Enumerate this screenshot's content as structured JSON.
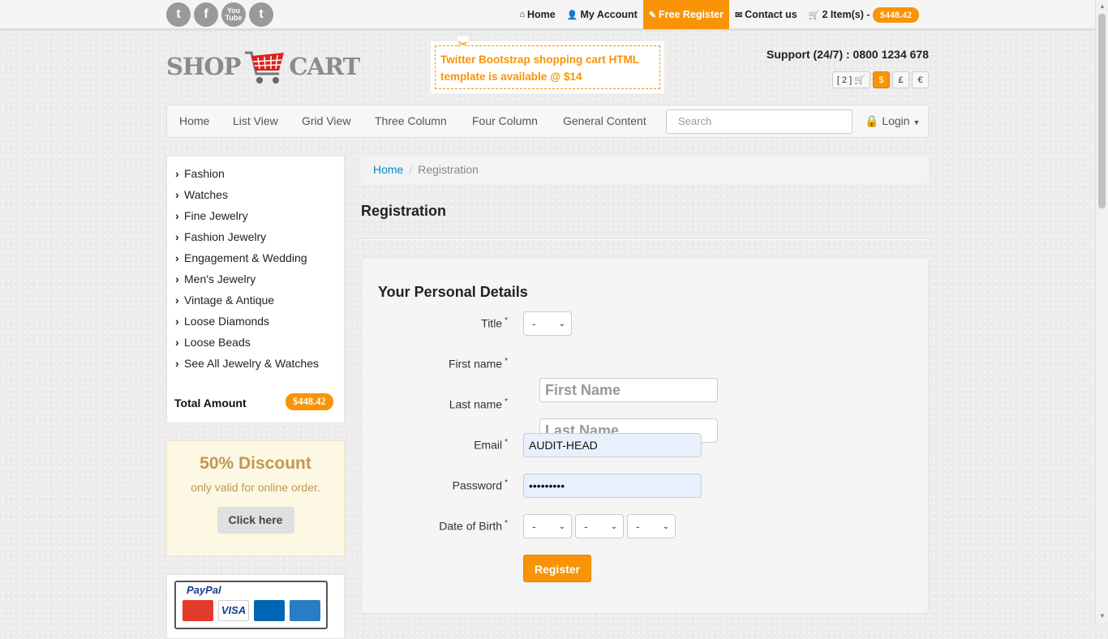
{
  "social": [
    {
      "icon": "twitter-icon",
      "glyph": "t"
    },
    {
      "icon": "facebook-icon",
      "glyph": "f"
    },
    {
      "icon": "youtube-icon",
      "glyph": "You Tube"
    },
    {
      "icon": "tumblr-icon",
      "glyph": "t"
    }
  ],
  "topnav": {
    "home": "Home",
    "account": "My Account",
    "register": "Free Register",
    "contact": "Contact us",
    "cart": "2 Item(s) -",
    "cart_total": "$448.42"
  },
  "logo": {
    "left": "SHOP",
    "right": "CART"
  },
  "promo": {
    "text_line1": "Twitter Bootstrap shopping cart HTML",
    "text_line2": "template is available @ $14"
  },
  "support": "Support (24/7) : 0800 1234 678",
  "currency": {
    "cart_count": "[ 2 ]",
    "usd": "$",
    "gbp": "£",
    "eur": "€",
    "selected": "$"
  },
  "nav": {
    "items": [
      "Home",
      "List View",
      "Grid View",
      "Three Column",
      "Four Column",
      "General Content"
    ],
    "search_placeholder": "Search",
    "login": "Login"
  },
  "categories": [
    "Fashion",
    "Watches",
    "Fine Jewelry",
    "Fashion Jewelry",
    "Engagement & Wedding",
    "Men's Jewelry",
    "Vintage & Antique",
    "Loose Diamonds",
    "Loose Beads",
    "See All Jewelry & Watches"
  ],
  "total": {
    "label": "Total Amount",
    "value": "$448.42"
  },
  "discount": {
    "title": "50% Discount",
    "text": "only valid for online order.",
    "button": "Click here"
  },
  "payment": {
    "label": "PayPal",
    "cards": [
      "MasterCard",
      "VISA",
      "Maestro",
      "AMERICAN EXPRESS"
    ]
  },
  "breadcrumb": {
    "home": "Home",
    "current": "Registration"
  },
  "page_title": "Registration",
  "form": {
    "heading": "Your Personal Details",
    "title_label": "Title",
    "title_value": "-",
    "first_label": "First name",
    "first_placeholder": "First Name",
    "last_label": "Last name",
    "last_placeholder": "Last Name",
    "email_label": "Email",
    "email_value": "AUDIT-HEAD",
    "password_label": "Password",
    "password_value": "•••••••••",
    "dob_label": "Date of Birth",
    "dob_values": [
      "-",
      "-",
      "-"
    ],
    "required_mark": "*",
    "submit": "Register"
  },
  "colors": {
    "accent": "#f89406",
    "link": "#0088cc",
    "discount_text": "#c09853"
  }
}
